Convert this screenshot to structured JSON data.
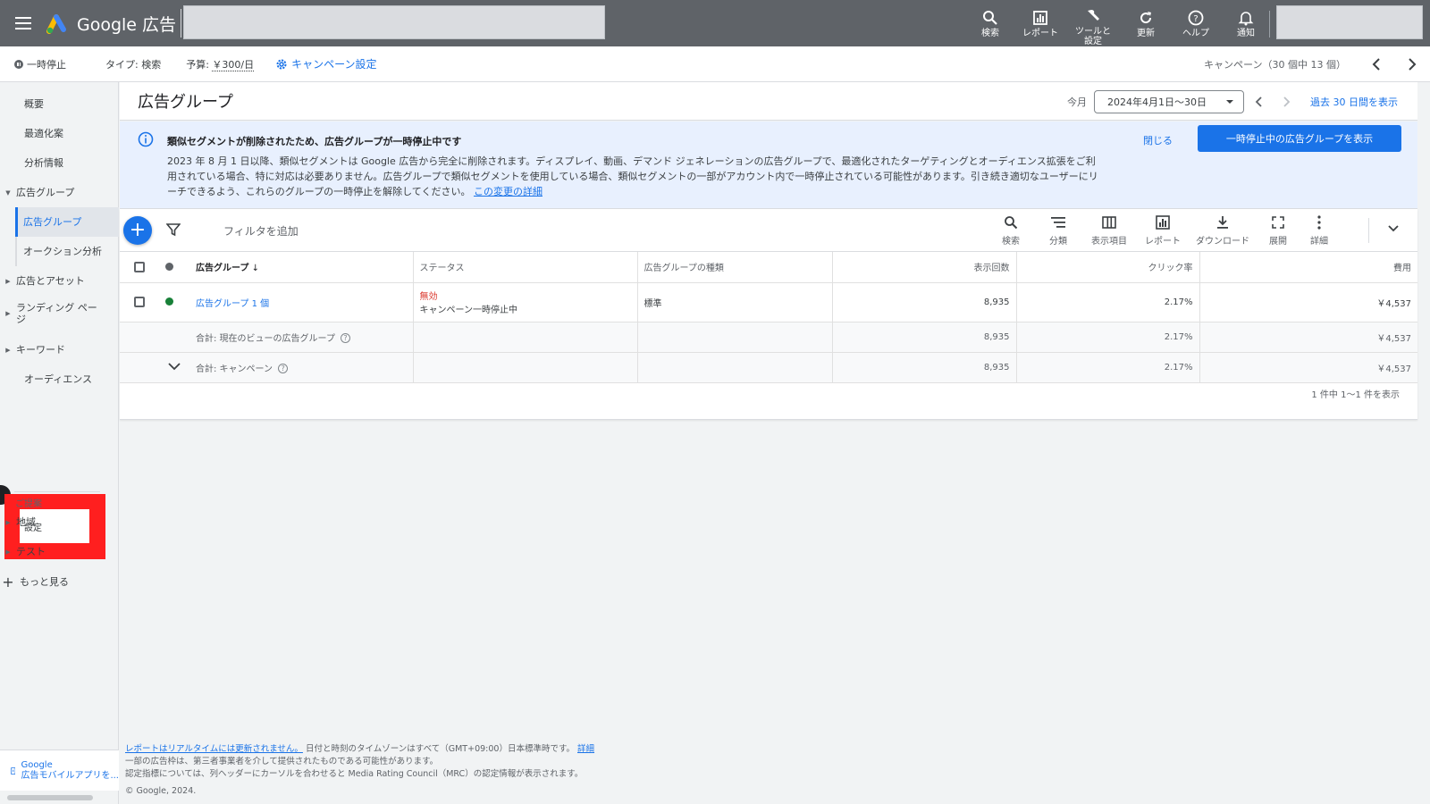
{
  "app": {
    "brand": "Google 広告"
  },
  "top_actions": [
    {
      "label": "検索",
      "icon": "search-icon"
    },
    {
      "label": "レポート",
      "icon": "report-icon"
    },
    {
      "label": "ツールと\n設定",
      "icon": "wrench-icon"
    },
    {
      "label": "更新",
      "icon": "refresh-icon"
    },
    {
      "label": "ヘルプ",
      "icon": "help-icon"
    },
    {
      "label": "通知",
      "icon": "bell-icon"
    }
  ],
  "campaign_bar": {
    "status": "一時停止",
    "type": "タイプ: 検索",
    "budget_label": "予算:",
    "budget_amount": "￥300/日",
    "settings": "キャンペーン設定",
    "count": "キャンペーン（30 個中 13 個）"
  },
  "sidebar": {
    "items": [
      {
        "label": "概要"
      },
      {
        "label": "最適化案"
      },
      {
        "label": "分析情報"
      },
      {
        "label": "広告グループ"
      },
      {
        "label": "広告グループ"
      },
      {
        "label": "オークション分析"
      },
      {
        "label": "広告とアセット"
      },
      {
        "label": "ランディング ページ"
      },
      {
        "label": "キーワード"
      },
      {
        "label": "オーディエンス"
      },
      {
        "label": "設定"
      },
      {
        "label": "地域"
      },
      {
        "label": "テスト"
      },
      {
        "label": "もっと見る"
      }
    ],
    "section_label": "ご提案",
    "mobile_line1": "Google",
    "mobile_line2": "広告モバイルアプリを..."
  },
  "header": {
    "title": "広告グループ",
    "date_label": "今月",
    "date_range": "2024年4月1日〜30日",
    "last30": "過去 30 日間を表示"
  },
  "banner": {
    "title": "類似セグメントが削除されたため、広告グループが一時停止中です",
    "body": "2023 年 8 月 1 日以降、類似セグメントは Google 広告から完全に削除されます。ディスプレイ、動画、デマンド ジェネレーションの広告グループで、最適化されたターゲティングとオーディエンス拡張をご利用されている場合、特に対応は必要ありません。広告グループで類似セグメントを使用している場合、類似セグメントの一部がアカウント内で一時停止されている可能性があります。引き続き適切なユーザーにリーチできるよう、これらのグループの一時停止を解除してください。",
    "link": "この変更の詳細",
    "close": "閉じる",
    "button": "一時停止中の広告グループを表示"
  },
  "toolbar": {
    "filter_placeholder": "フィルタを追加",
    "tools": [
      {
        "label": "検索",
        "icon": "search-icon"
      },
      {
        "label": "分類",
        "icon": "segment-icon"
      },
      {
        "label": "表示項目",
        "icon": "columns-icon"
      },
      {
        "label": "レポート",
        "icon": "report-icon"
      },
      {
        "label": "ダウンロード",
        "icon": "download-icon"
      },
      {
        "label": "展開",
        "icon": "expand-icon"
      },
      {
        "label": "詳細",
        "icon": "more-icon"
      }
    ]
  },
  "table": {
    "headers": {
      "ad_group": "広告グループ",
      "status": "ステータス",
      "type": "広告グループの種類",
      "impressions": "表示回数",
      "ctr": "クリック率",
      "cost": "費用"
    },
    "rows": [
      {
        "ad_group": "広告グループ 1 個",
        "status": "無効",
        "status_sub": "キャンペーン一時停止中",
        "type": "標準",
        "impressions": "8,935",
        "ctr": "2.17%",
        "cost": "￥4,537"
      }
    ],
    "totals": [
      {
        "label": "合計: 現在のビューの広告グループ",
        "impressions": "8,935",
        "ctr": "2.17%",
        "cost": "￥4,537"
      },
      {
        "label": "合計: キャンペーン",
        "impressions": "8,935",
        "ctr": "2.17%",
        "cost": "￥4,537"
      }
    ],
    "pagination": "1 件中 1〜1 件を表示"
  },
  "footer": {
    "line1_link": "レポートはリアルタイムには更新されません。",
    "line1_text": " 日付と時刻のタイムゾーンはすべて（GMT+09:00）日本標準時です。",
    "line1_detail": "詳細",
    "line2": "一部の広告枠は、第三者事業者を介して提供されたものである可能性があります。",
    "line3": "認定指標については、列ヘッダーにカーソルを合わせると Media Rating Council（MRC）の認定情報が表示されます。",
    "line4": "© Google, 2024."
  },
  "colors": {
    "accent": "#1a73e8",
    "topbar": "#5f6368",
    "error": "#d93025",
    "enabled": "#188038",
    "highlight": "#ff1f1f"
  }
}
